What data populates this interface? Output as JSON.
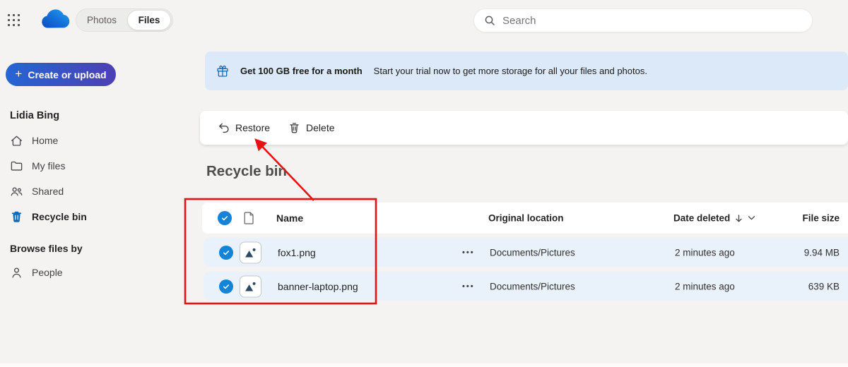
{
  "topbar": {
    "toggle": {
      "photos": "Photos",
      "files": "Files"
    },
    "search": {
      "placeholder": "Search"
    }
  },
  "sidebar": {
    "create_button": "Create or upload",
    "user_name": "Lidia Bing",
    "items": [
      {
        "label": "Home"
      },
      {
        "label": "My files"
      },
      {
        "label": "Shared"
      },
      {
        "label": "Recycle bin",
        "active": true
      }
    ],
    "section_header": "Browse files by",
    "browse_items": [
      {
        "label": "People"
      }
    ]
  },
  "banner": {
    "title": "Get 100 GB free for a month",
    "subtitle": "Start your trial now to get more storage for all your files and photos."
  },
  "toolbar": {
    "restore": "Restore",
    "delete": "Delete"
  },
  "page": {
    "title": "Recycle bin"
  },
  "table": {
    "headers": {
      "name": "Name",
      "location": "Original location",
      "date": "Date deleted",
      "size": "File size"
    },
    "sort": {
      "column": "Date deleted",
      "direction": "descending"
    },
    "rows": [
      {
        "name": "fox1.png",
        "location": "Documents/Pictures",
        "date": "2 minutes ago",
        "size": "9.94 MB",
        "selected": true
      },
      {
        "name": "banner-laptop.png",
        "location": "Documents/Pictures",
        "date": "2 minutes ago",
        "size": "639 KB",
        "selected": true
      }
    ],
    "more_options_glyph": "•••"
  },
  "colors": {
    "accent_blue": "#1583d7",
    "icon_blue": "#0f6cbd",
    "selected_row": "#e9f2fb",
    "banner_bg": "#dce9f8",
    "annotation_red": "#e81212",
    "create_button_gradient": [
      "#2566d3",
      "#4d3fb4"
    ]
  }
}
